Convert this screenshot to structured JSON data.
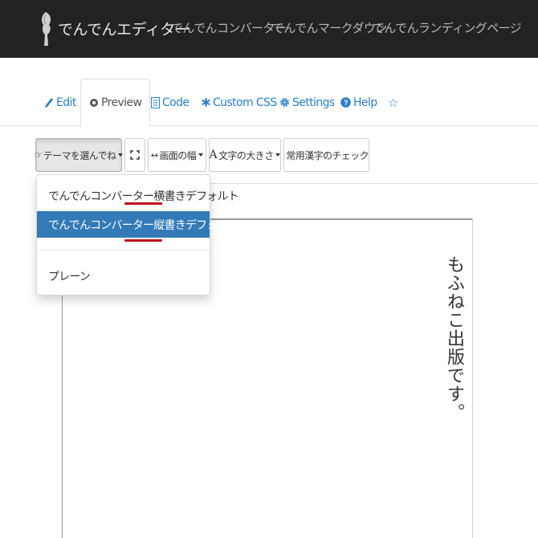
{
  "navbar": {
    "brand": "でんでんエディター",
    "links": [
      "でんでんコンバーター",
      "でんでんマークダウン",
      "でんでんランディングページ"
    ]
  },
  "tabs": [
    {
      "label": "Edit",
      "icon": "pencil-icon"
    },
    {
      "label": "Preview",
      "icon": "eye-icon"
    },
    {
      "label": "Code",
      "icon": "document-icon"
    },
    {
      "label": "Custom CSS",
      "icon": "asterisk-icon"
    },
    {
      "label": "Settings",
      "icon": "gear-icon"
    },
    {
      "label": "Help",
      "icon": "question-circle-icon"
    },
    {
      "label": "",
      "icon": "star-icon"
    }
  ],
  "toolbar": {
    "theme_label": "テーマを選んでね",
    "fullscreen_icon": "fullscreen-icon",
    "width_label": "画面の幅",
    "font_size_glyph": "A",
    "font_size_label": "文字の大きさ",
    "kanji_check_label": "常用漢字のチェック"
  },
  "theme_menu": {
    "items": [
      "でんでんコンバーター横書きデフォルト",
      "でんでんコンバーター縦書きデフォルト",
      "プレーン"
    ],
    "selected_index": 1
  },
  "preview": {
    "text": "もふねこ出版です。"
  },
  "colors": {
    "navbar_bg": "#222222",
    "link_blue": "#2a7fc9",
    "selected_bg": "#337ab7",
    "annotation_red": "#c0101a"
  }
}
